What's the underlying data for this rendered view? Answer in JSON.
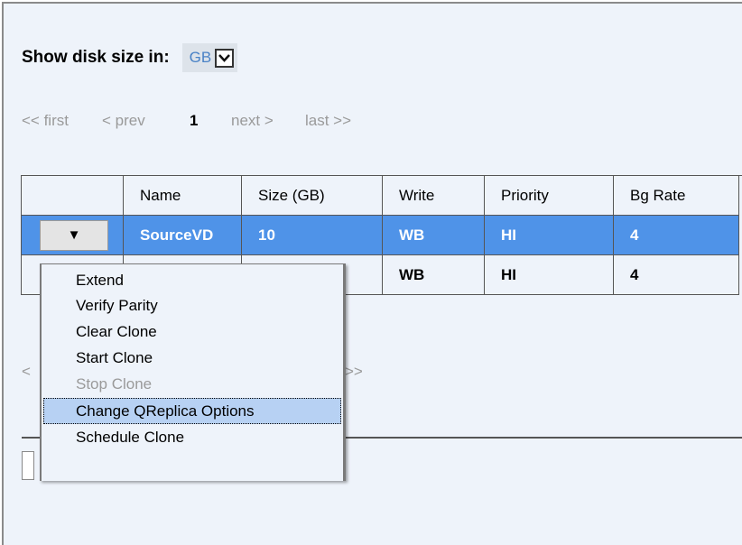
{
  "disk_size": {
    "label": "Show disk size in:",
    "selected": "GB"
  },
  "pager_top": {
    "first": "<< first",
    "prev": "< prev",
    "current": "1",
    "next": "next >",
    "last": "last >>"
  },
  "table": {
    "headers": [
      "",
      "Name",
      "Size (GB)",
      "Write",
      "Priority",
      "Bg Rate"
    ],
    "dropdown_button": "▼",
    "rows": [
      {
        "name": "SourceVD",
        "size": "10",
        "write": "WB",
        "priority": "HI",
        "bg_rate": "4"
      },
      {
        "name": "",
        "size": "",
        "write": "WB",
        "priority": "HI",
        "bg_rate": "4"
      }
    ]
  },
  "pager_bottom": {
    "first_partial": "<",
    "last_partial": ">>"
  },
  "context_menu": {
    "items": [
      {
        "label": "Extend",
        "disabled": false,
        "highlighted": false
      },
      {
        "label": "Verify Parity",
        "disabled": false,
        "highlighted": false
      },
      {
        "label": "Clear Clone",
        "disabled": false,
        "highlighted": false
      },
      {
        "label": "Start Clone",
        "disabled": false,
        "highlighted": false
      },
      {
        "label": "Stop Clone",
        "disabled": true,
        "highlighted": false
      },
      {
        "label": "Change QReplica Options",
        "disabled": false,
        "highlighted": true
      },
      {
        "label": "Schedule Clone",
        "disabled": false,
        "highlighted": false
      }
    ]
  },
  "colors": {
    "selected_row": "#4f93e8",
    "panel_bg": "#eef3fa",
    "menu_highlight": "#b7d1f3",
    "link_gray": "#9a9a9a"
  }
}
